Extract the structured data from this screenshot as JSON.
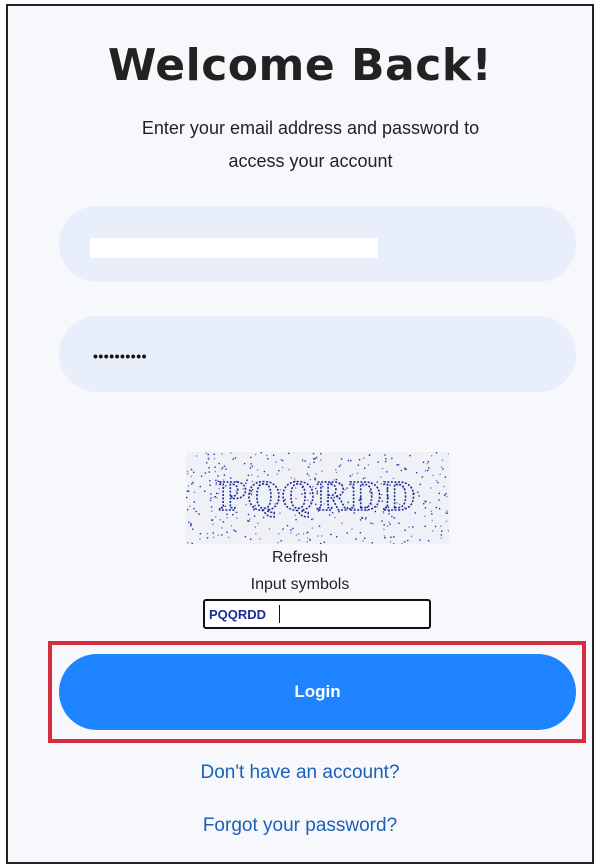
{
  "header": {
    "title": "Welcome Back!",
    "subtitle": "Enter your email address and password to access your account"
  },
  "form": {
    "email_value": "",
    "password_value": "••••••••••"
  },
  "captcha": {
    "image_text": "PQQRDD",
    "refresh_label": "Refresh",
    "input_label": "Input symbols",
    "input_value": "PQQRDD"
  },
  "actions": {
    "login_label": "Login",
    "signup_link": "Don't have an account?",
    "forgot_link": "Forgot your password?"
  },
  "colors": {
    "primary": "#1f84ff",
    "field_bg": "#e8eefa",
    "highlight": "#d32f3f",
    "link": "#1b5fb8"
  }
}
